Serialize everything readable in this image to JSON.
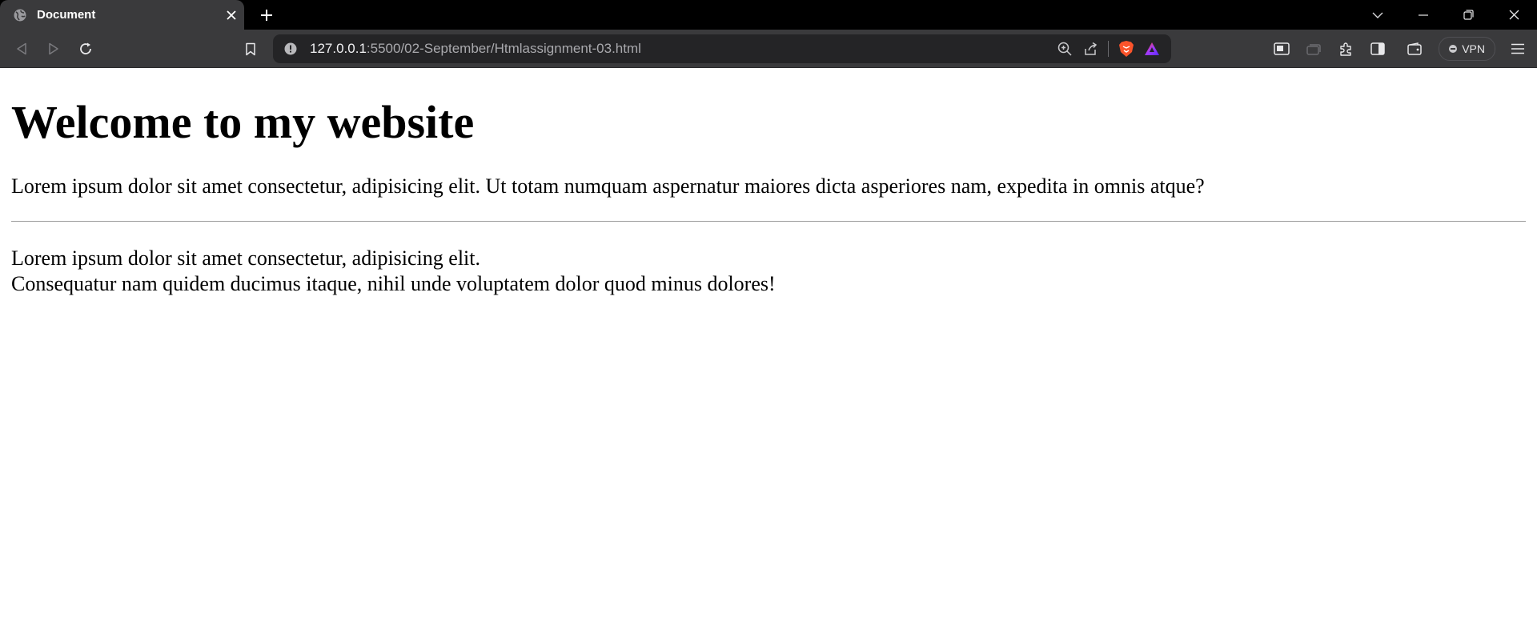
{
  "browser": {
    "tab": {
      "title": "Document",
      "favicon": "globe-icon"
    },
    "new_tab_icon": "plus-icon",
    "window_controls": [
      "tab-search-icon",
      "minimize-icon",
      "restore-icon",
      "close-icon"
    ],
    "address_bar": {
      "url_host": "127.0.0.1",
      "url_rest": ":5500/02-September/Htmlassignment-03.html"
    },
    "vpn_label": "VPN"
  },
  "page": {
    "heading": "Welcome to my website",
    "paragraph1": "Lorem ipsum dolor sit amet consectetur, adipisicing elit. Ut totam numquam aspernatur maiores dicta asperiores nam, expedita in omnis atque?",
    "paragraph2_line1": "Lorem ipsum dolor sit amet consectetur, adipisicing elit.",
    "paragraph2_line2": "Consequatur nam quidem ducimus itaque, nihil unde voluptatem dolor quod minus dolores!"
  }
}
